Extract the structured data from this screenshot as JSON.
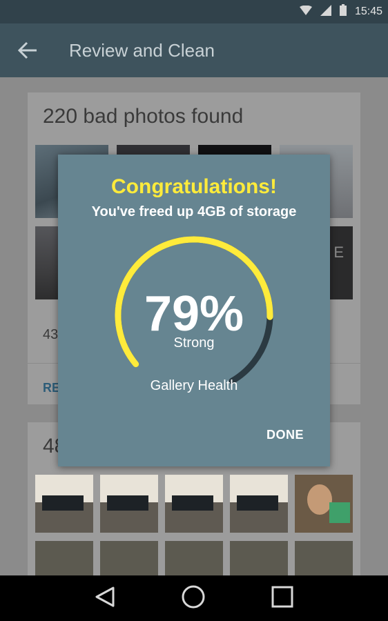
{
  "status_bar": {
    "time": "15:45",
    "icons": [
      "wifi-icon",
      "signal-icon",
      "battery-icon"
    ]
  },
  "app_bar": {
    "title": "Review and Clean",
    "back_icon": "arrow-back-icon"
  },
  "card1": {
    "title": "220 bad photos found",
    "subtitle": "43",
    "action": "RE",
    "thumb_overlay": "2 E"
  },
  "card2": {
    "title": "48"
  },
  "dialog": {
    "title": "Congratulations!",
    "subtitle": "You've freed up 4GB of storage",
    "gauge": {
      "value": "79%",
      "fraction": 0.79,
      "label": "Strong",
      "caption": "Gallery Health"
    },
    "done_label": "DONE"
  },
  "nav_bar": {
    "buttons": [
      "back-triangle-icon",
      "home-circle-icon",
      "recents-square-icon"
    ]
  },
  "colors": {
    "accent": "#ffeb3b",
    "dialog_bg": "#668591",
    "track": "#2b3a42",
    "appbar": "#3e535d"
  }
}
